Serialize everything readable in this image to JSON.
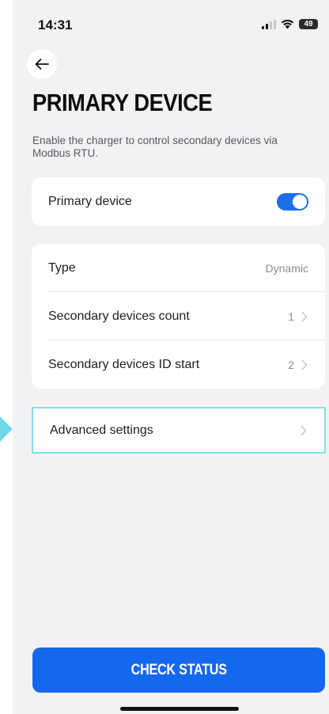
{
  "status_bar": {
    "time": "14:31",
    "battery_level": "49",
    "icons": [
      "signal-icon",
      "wifi-icon",
      "battery-icon"
    ]
  },
  "header": {
    "back_icon": "arrow-left-icon",
    "title": "PRIMARY DEVICE",
    "description": "Enable the charger to control secondary devices via Modbus RTU."
  },
  "primary_toggle": {
    "label": "Primary device",
    "enabled": true
  },
  "settings": [
    {
      "label": "Type",
      "value": "Dynamic",
      "has_chevron": false
    },
    {
      "label": "Secondary devices count",
      "value": "1",
      "has_chevron": true
    },
    {
      "label": "Secondary devices ID start",
      "value": "2",
      "has_chevron": true
    }
  ],
  "advanced": {
    "label": "Advanced settings"
  },
  "footer": {
    "check_status_label": "CHECK STATUS"
  },
  "colors": {
    "accent": "#1368ee",
    "highlight": "#7de0ea",
    "background": "#f2f2f4"
  }
}
